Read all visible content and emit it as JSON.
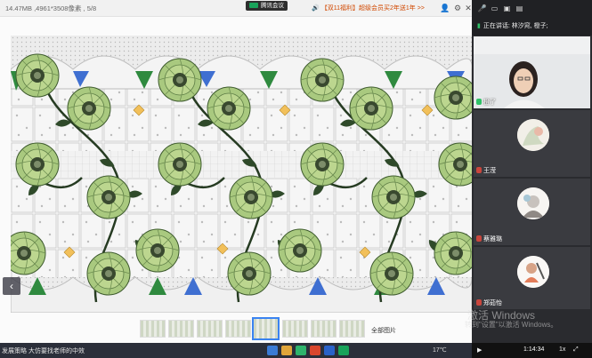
{
  "viewer": {
    "file_info": "14.47MB ,4961*3508像素 , 5/8",
    "meeting_label": "腾讯会议",
    "notice": "【双11福利】超级会员买2年送1年 >>",
    "all_images": "全部图片",
    "thumbnail_count": 8,
    "active_thumbnail": 5
  },
  "panel": {
    "speaking_prefix": "正在讲话:",
    "speaking_names": "林汐窕, 橙子;",
    "participants": [
      {
        "name": "橙了",
        "type": "video"
      },
      {
        "name": "王滢",
        "type": "avatar"
      },
      {
        "name": "蔡雅璐",
        "type": "avatar"
      },
      {
        "name": "郑茹怡",
        "type": "avatar"
      }
    ]
  },
  "watermark": {
    "line1": "激活 Windows",
    "line2": "转到\"设置\"以激活 Windows。"
  },
  "playback": {
    "time": "1:14:34",
    "speed": "1x"
  },
  "taskbar": {
    "ticker": "发展策略 大仿要找老师的中效",
    "tray_temp": "17℃"
  },
  "colors": {
    "accent_green": "#2fc167",
    "meeting_green": "#19a35a",
    "notice_orange": "#d14800",
    "thumb_active": "#3a83f1",
    "leaf_green": "#a5c77a",
    "dark_leaf": "#2f4a2a",
    "tile_blue": "#3f6fd1",
    "tile_green": "#2f8a3f",
    "diamond_gold": "#f2c05a"
  },
  "icons": {
    "speaker": "speaker-icon",
    "mic": "mic-icon",
    "settings": "gear-icon",
    "close": "close-icon"
  }
}
